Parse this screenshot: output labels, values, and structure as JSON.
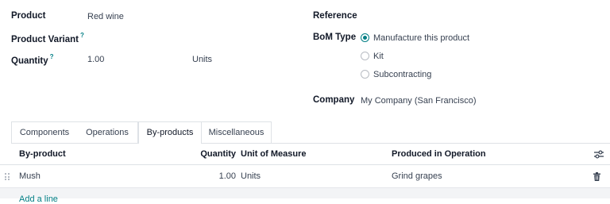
{
  "form": {
    "product": {
      "label": "Product",
      "value": "Red wine"
    },
    "variant": {
      "label": "Product Variant",
      "help": "?"
    },
    "quantity": {
      "label": "Quantity",
      "help": "?",
      "value": "1.00",
      "uom": "Units"
    },
    "reference": {
      "label": "Reference",
      "value": ""
    },
    "bom_type": {
      "label": "BoM Type",
      "options": [
        {
          "label": "Manufacture this product",
          "selected": true
        },
        {
          "label": "Kit",
          "selected": false
        },
        {
          "label": "Subcontracting",
          "selected": false
        }
      ]
    },
    "company": {
      "label": "Company",
      "value": "My Company (San Francisco)"
    }
  },
  "tabs": [
    {
      "label": "Components",
      "active": false
    },
    {
      "label": "Operations",
      "active": false
    },
    {
      "label": "By-products",
      "active": true
    },
    {
      "label": "Miscellaneous",
      "active": false
    }
  ],
  "table": {
    "headers": {
      "byproduct": "By-product",
      "quantity": "Quantity",
      "uom": "Unit of Measure",
      "operation": "Produced in Operation"
    },
    "rows": [
      {
        "byproduct": "Mush",
        "quantity": "1.00",
        "uom": "Units",
        "operation": "Grind grapes"
      }
    ],
    "add_line": "Add a line"
  },
  "colors": {
    "accent": "#017e84",
    "border": "#dee2e6"
  },
  "icons": {
    "columns": "sliders-icon",
    "delete": "trash-icon",
    "drag": "drag-handle-icon"
  }
}
